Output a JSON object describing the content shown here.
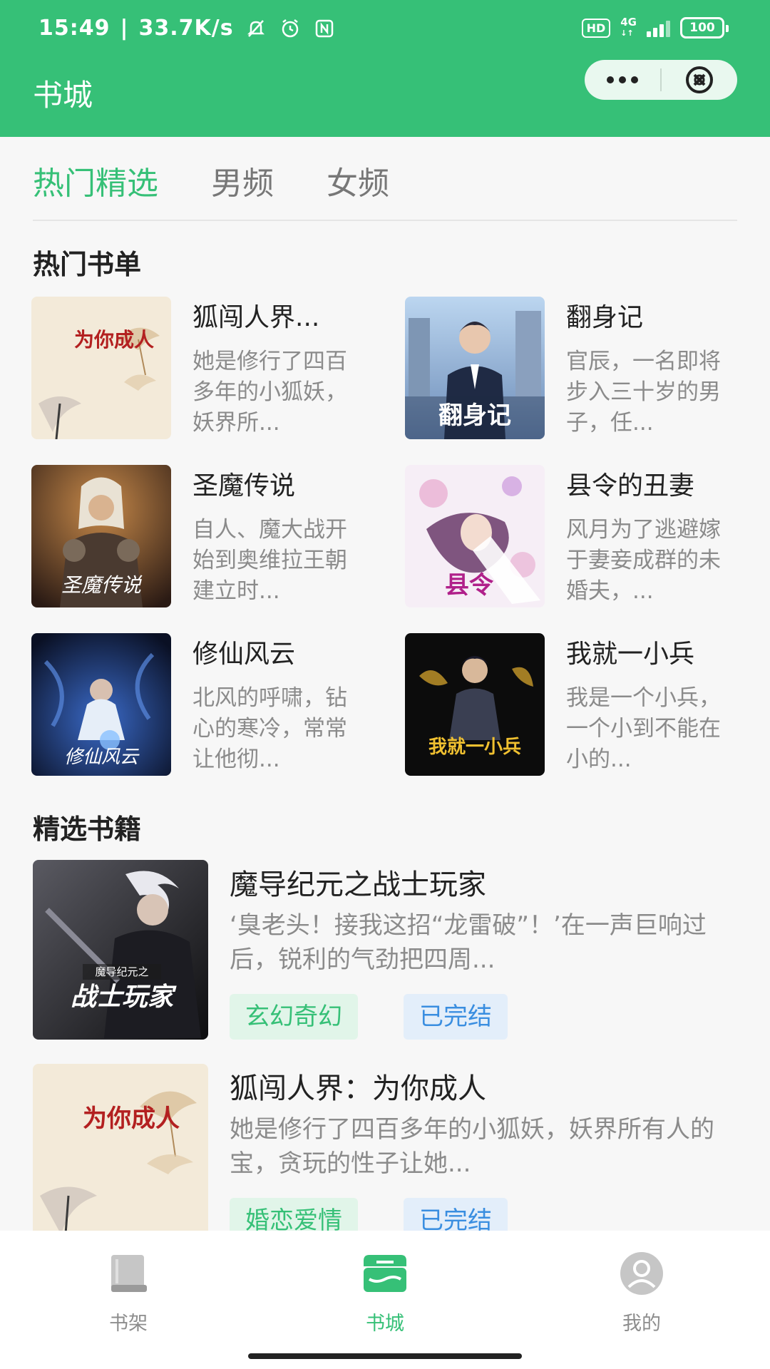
{
  "status_bar": {
    "time": "15:49",
    "speed": "33.7K/s",
    "hd": "HD",
    "network": "4G",
    "network_sub": "↓↑",
    "battery": "100"
  },
  "header": {
    "title": "书城",
    "accent_color": "#36c077"
  },
  "tabs": [
    {
      "label": "热门精选",
      "active": true
    },
    {
      "label": "男频",
      "active": false
    },
    {
      "label": "女频",
      "active": false
    }
  ],
  "hot_lists": {
    "title": "热门书单",
    "items": [
      {
        "title": "狐闯人界...",
        "desc": "她是修行了四百多年的小狐妖，妖界所...",
        "cover_icon": "fox-romance-cover"
      },
      {
        "title": "翻身记",
        "desc": "官辰，一名即将步入三十岁的男子，任...",
        "cover_icon": "city-suit-cover",
        "cover_text": "翻身记"
      },
      {
        "title": "圣魔传说",
        "desc": "自人、魔大战开始到奥维拉王朝建立时...",
        "cover_icon": "armored-warrior-cover",
        "cover_text": "圣魔传说"
      },
      {
        "title": "县令的丑妻",
        "desc": "风月为了逃避嫁于妻妾成群的未婚夫，...",
        "cover_icon": "flower-girl-cover",
        "cover_text": "县令"
      },
      {
        "title": "修仙风云",
        "desc": "北风的呼啸，钻心的寒冷，常常让他彻...",
        "cover_icon": "cultivator-cover",
        "cover_text": "修仙风云"
      },
      {
        "title": "我就一小兵",
        "desc": "我是一个小兵，一个小到不能在小的...",
        "cover_icon": "soldier-cover",
        "cover_text": "我就一小兵"
      }
    ]
  },
  "featured": {
    "title": "精选书籍",
    "items": [
      {
        "title": "魔导纪元之战士玩家",
        "desc": "‘臭老头！接我这招“龙雷破”！’在一声巨响过后，锐利的气劲把四周...",
        "genre": "玄幻奇幻",
        "status": "已完结",
        "cover_icon": "warrior-player-cover",
        "cover_text": "战士玩家",
        "cover_subtext": "魔导纪元之"
      },
      {
        "title": "狐闯人界：为你成人",
        "desc": "她是修行了四百多年的小狐妖，妖界所有人的宝，贪玩的性子让她...",
        "genre": "婚恋爱情",
        "status": "已完结",
        "cover_icon": "fox-romance-cover"
      }
    ]
  },
  "cover_text_fox": "为你成人",
  "bottom_nav": [
    {
      "label": "书架",
      "icon": "bookshelf-icon",
      "active": false
    },
    {
      "label": "书城",
      "icon": "bookstore-icon",
      "active": true
    },
    {
      "label": "我的",
      "icon": "profile-icon",
      "active": false
    }
  ]
}
